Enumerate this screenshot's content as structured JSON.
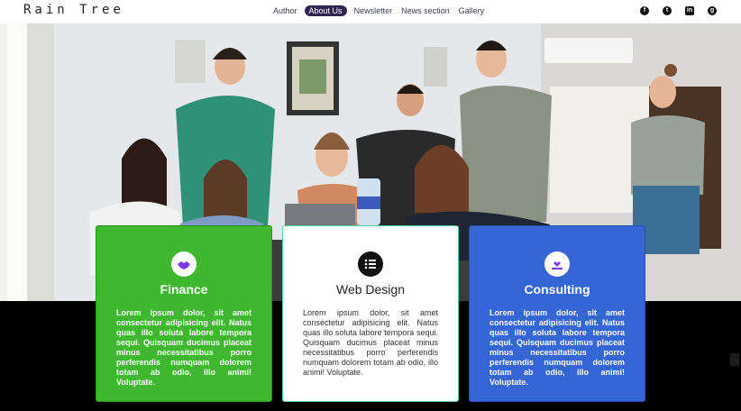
{
  "navbar": {
    "brand": "Rain Tree",
    "links": [
      {
        "label": "Author",
        "active": false
      },
      {
        "label": "About Us",
        "active": true
      },
      {
        "label": "Newsletter",
        "active": false
      },
      {
        "label": "News section",
        "active": false
      },
      {
        "label": "Gallery",
        "active": false
      }
    ],
    "social": [
      {
        "icon": "facebook-icon",
        "glyph": "f"
      },
      {
        "icon": "twitter-icon",
        "glyph": "t"
      },
      {
        "icon": "linkedin-icon",
        "glyph": "in"
      },
      {
        "icon": "github-icon",
        "glyph": "g"
      }
    ]
  },
  "cards": [
    {
      "title": "Finance",
      "icon": "handshake-icon",
      "text": "Lorem ipsum dolor, sit amet consectetur adipisicing elit. Natus quas illo soluta labore tempora sequi. Quisquam ducimus placeat minus necessitatibus porro perferendis numquam dolorem totam ab odio, illo animi! Voluptate.",
      "color": "#3fb82f"
    },
    {
      "title": "Web Design",
      "icon": "list-icon",
      "text": "Lorem ipsum dolor, sit amet consectetur adipisicing elit. Natus quas illo soluta labore tempora sequi. Quisquam ducimus placeat minus necessitatibus porro perferendis numquam dolorem totam ab odio, illo animi! Voluptate.",
      "color": "#ffffff"
    },
    {
      "title": "Consulting",
      "icon": "hand-heart-icon",
      "text": "Lorem ipsum dolor, sit amet consectetur adipisicing elit. Natus quas illo soluta labore tempora sequi. Quisquam ducimus placeat minus necessitatibus porro perferendis numquam dolorem totam ab odio, illo animi! Voluptate.",
      "color": "#3466d6"
    }
  ],
  "colors": {
    "accent": "#2f2650",
    "background": "#000000"
  }
}
